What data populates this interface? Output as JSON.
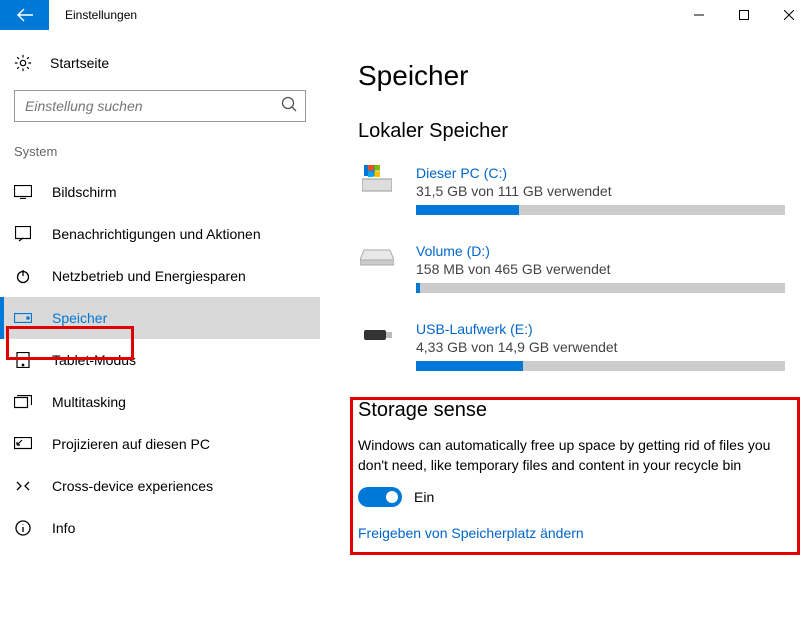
{
  "window": {
    "title": "Einstellungen"
  },
  "sidebar": {
    "home": "Startseite",
    "searchPlaceholder": "Einstellung suchen",
    "section": "System",
    "items": [
      {
        "label": "Bildschirm"
      },
      {
        "label": "Benachrichtigungen und Aktionen"
      },
      {
        "label": "Netzbetrieb und Energiesparen"
      },
      {
        "label": "Speicher"
      },
      {
        "label": "Tablet-Modus"
      },
      {
        "label": "Multitasking"
      },
      {
        "label": "Projizieren auf diesen PC"
      },
      {
        "label": "Cross-device experiences"
      },
      {
        "label": "Info"
      }
    ]
  },
  "main": {
    "title": "Speicher",
    "localTitle": "Lokaler Speicher",
    "drives": [
      {
        "name": "Dieser PC (C:)",
        "usage": "31,5 GB von 111 GB verwendet",
        "percent": 28
      },
      {
        "name": "Volume (D:)",
        "usage": "158 MB von 465 GB verwendet",
        "percent": 1
      },
      {
        "name": "USB-Laufwerk (E:)",
        "usage": "4,33 GB von 14,9 GB verwendet",
        "percent": 29
      }
    ],
    "sense": {
      "title": "Storage sense",
      "desc": "Windows can automatically free up space by getting rid of files you don't need, like temporary files and content in your recycle bin",
      "toggleLabel": "Ein"
    },
    "link": "Freigeben von Speicherplatz ändern"
  }
}
